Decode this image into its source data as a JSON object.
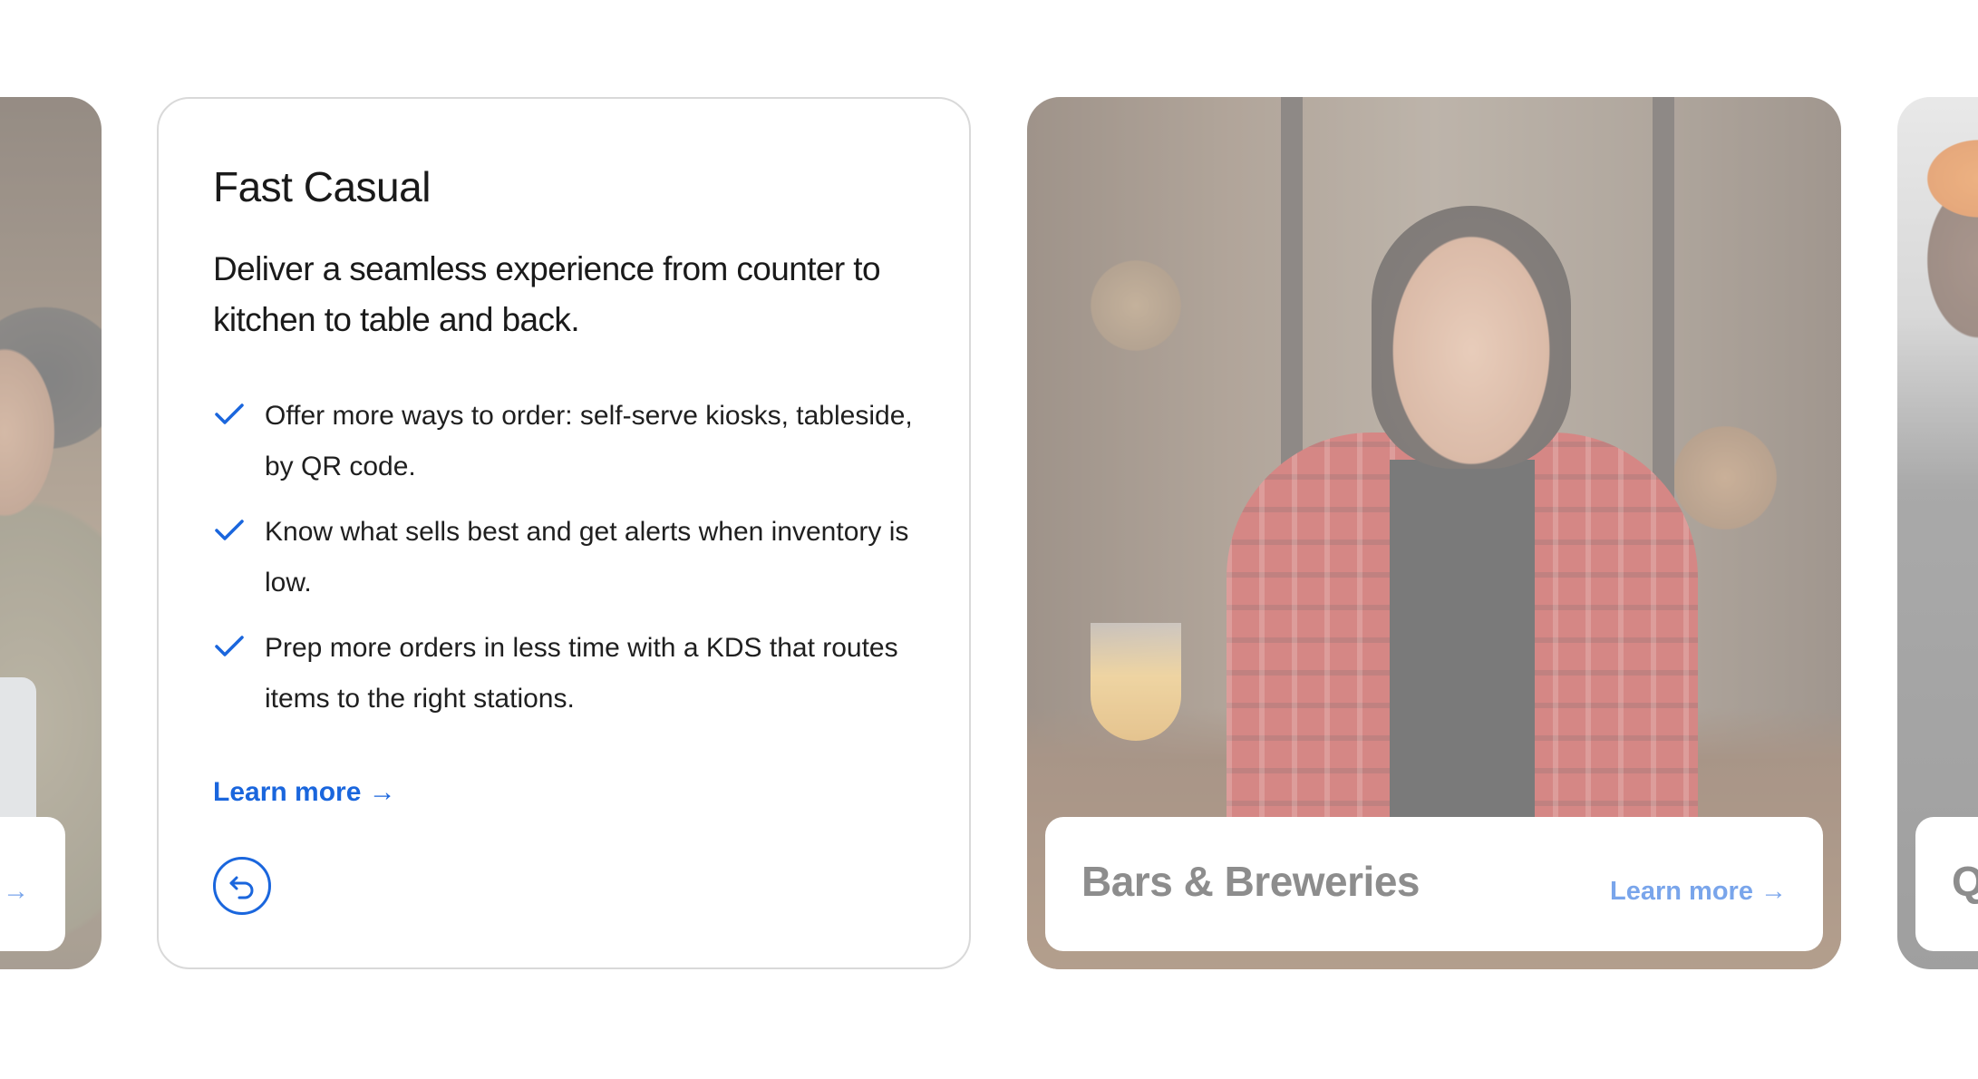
{
  "cards": {
    "left": {
      "link_label": "Learn more →"
    },
    "fast_casual": {
      "title": "Fast Casual",
      "subtitle": "Deliver a seamless experience from counter to kitchen to table and back.",
      "features": [
        "Offer more ways to order: self-serve kiosks, tableside, by QR code.",
        "Know what sells best and get alerts when inventory is low.",
        "Prep more orders in less time with a KDS that routes items to the right stations."
      ],
      "link_label": "Learn more →",
      "back_icon": "back-arrow-circle-icon"
    },
    "bars": {
      "title": "Bars & Breweries",
      "link_label": "Learn more →"
    },
    "right": {
      "title": "Q"
    }
  },
  "colors": {
    "accent": "#1a66dd",
    "text": "#1a1a1a",
    "border": "#d9d9d9"
  }
}
